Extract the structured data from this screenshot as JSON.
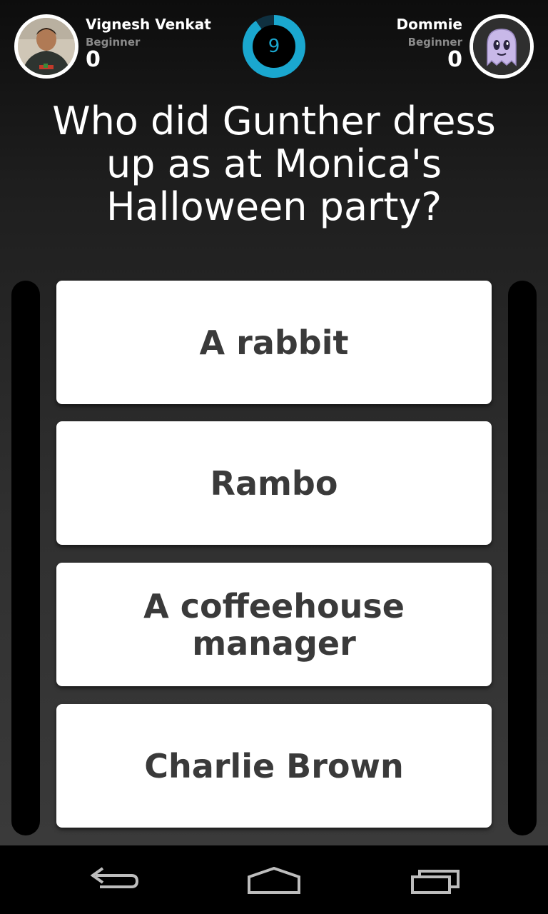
{
  "header": {
    "player1": {
      "name": "Vignesh Venkat",
      "level": "Beginner",
      "score": "0",
      "avatar_icon": "user-photo-avatar"
    },
    "player2": {
      "name": "Dommie",
      "level": "Beginner",
      "score": "0",
      "avatar_icon": "ghost-icon"
    },
    "timer": {
      "value": "9",
      "remaining_fraction": 0.9,
      "color": "#1aa7cf"
    }
  },
  "question": {
    "text": "Who did Gunther dress up as at Monica's Halloween party?"
  },
  "answers": [
    {
      "label": "A rabbit"
    },
    {
      "label": "Rambo"
    },
    {
      "label": "A coffeehouse manager"
    },
    {
      "label": "Charlie Brown"
    }
  ],
  "nav": {
    "back_icon": "back-icon",
    "home_icon": "home-icon",
    "recents_icon": "recent-apps-icon"
  },
  "colors": {
    "accent": "#1aa7cf",
    "answer_text": "#3a3a3a",
    "muted_text": "#8a8a8a"
  }
}
